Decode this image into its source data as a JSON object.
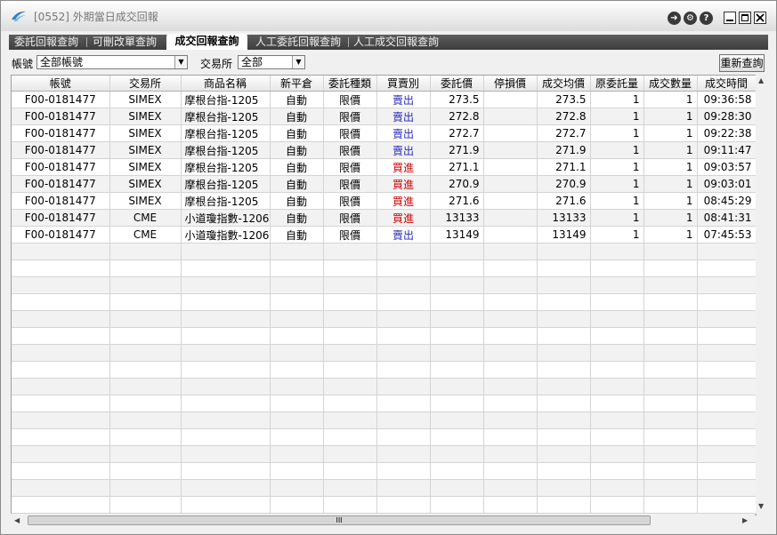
{
  "window": {
    "title": "[0552] 外期當日成交回報",
    "colors": {
      "tab_bar": "#4a4a4a",
      "sell": "#2a2abb",
      "buy": "#cc0000"
    }
  },
  "tabs": [
    {
      "label": "委託回報查詢",
      "active": false
    },
    {
      "label": "可刪改單查詢",
      "active": false
    },
    {
      "label": "成交回報查詢",
      "active": true
    },
    {
      "label": "人工委託回報查詢",
      "active": false
    },
    {
      "label": "人工成交回報查詢",
      "active": false
    }
  ],
  "filters": {
    "account_label": "帳號",
    "account_value": "全部帳號",
    "exchange_label": "交易所",
    "exchange_value": "全部",
    "requery_label": "重新查詢"
  },
  "table": {
    "headers": [
      "帳號",
      "交易所",
      "商品名稱",
      "新平倉",
      "委託種類",
      "買賣別",
      "委託價",
      "停損價",
      "成交均價",
      "原委託量",
      "成交數量",
      "成交時間"
    ],
    "rows": [
      [
        "F00-0181477",
        "SIMEX",
        "摩根台指-1205",
        "自動",
        "限價",
        "賣出",
        "273.5",
        "",
        "273.5",
        "1",
        "1",
        "09:36:58"
      ],
      [
        "F00-0181477",
        "SIMEX",
        "摩根台指-1205",
        "自動",
        "限價",
        "賣出",
        "272.8",
        "",
        "272.8",
        "1",
        "1",
        "09:28:30"
      ],
      [
        "F00-0181477",
        "SIMEX",
        "摩根台指-1205",
        "自動",
        "限價",
        "賣出",
        "272.7",
        "",
        "272.7",
        "1",
        "1",
        "09:22:38"
      ],
      [
        "F00-0181477",
        "SIMEX",
        "摩根台指-1205",
        "自動",
        "限價",
        "賣出",
        "271.9",
        "",
        "271.9",
        "1",
        "1",
        "09:11:47"
      ],
      [
        "F00-0181477",
        "SIMEX",
        "摩根台指-1205",
        "自動",
        "限價",
        "買進",
        "271.1",
        "",
        "271.1",
        "1",
        "1",
        "09:03:57"
      ],
      [
        "F00-0181477",
        "SIMEX",
        "摩根台指-1205",
        "自動",
        "限價",
        "買進",
        "270.9",
        "",
        "270.9",
        "1",
        "1",
        "09:03:01"
      ],
      [
        "F00-0181477",
        "SIMEX",
        "摩根台指-1205",
        "自動",
        "限價",
        "買進",
        "271.6",
        "",
        "271.6",
        "1",
        "1",
        "08:45:29"
      ],
      [
        "F00-0181477",
        "CME",
        "小道瓊指數-1206",
        "自動",
        "限價",
        "買進",
        "13133",
        "",
        "13133",
        "1",
        "1",
        "08:41:31"
      ],
      [
        "F00-0181477",
        "CME",
        "小道瓊指數-1206",
        "自動",
        "限價",
        "賣出",
        "13149",
        "",
        "13149",
        "1",
        "1",
        "07:45:53"
      ]
    ]
  },
  "icons": [
    "app-logo-icon",
    "exit-icon",
    "settings-icon",
    "help-icon",
    "minimize-icon",
    "maximize-icon",
    "close-icon",
    "scroll-up-icon",
    "scroll-down-icon",
    "scroll-left-icon",
    "scroll-right-icon"
  ],
  "scrollbar": {
    "thumb_grip": "III"
  }
}
